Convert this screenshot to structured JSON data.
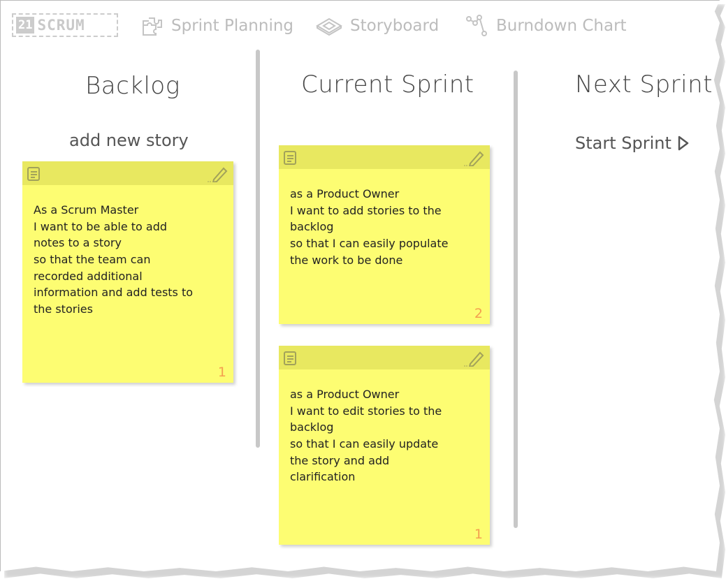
{
  "app": {
    "logo_number": "21",
    "logo_text": "SCRUM"
  },
  "nav": [
    {
      "label": "Sprint Planning",
      "icon": "puzzle-icon"
    },
    {
      "label": "Storyboard",
      "icon": "storyboard-icon"
    },
    {
      "label": "Burndown Chart",
      "icon": "burndown-icon"
    }
  ],
  "columns": {
    "backlog": {
      "title": "Backlog",
      "action": "add new story"
    },
    "current": {
      "title": "Current Sprint"
    },
    "next": {
      "title": "Next Sprint",
      "action": "Start Sprint"
    }
  },
  "stories": {
    "backlog": [
      {
        "text": "As a Scrum Master\nI want to be able to add\nnotes to a story\nso that the team can\nrecorded additional\ninformation and add tests to\nthe stories",
        "points": "1"
      }
    ],
    "current": [
      {
        "text": "as a Product Owner\nI want to add stories to the\nbacklog\nso that I can easily populate\nthe work to be done",
        "points": "2"
      },
      {
        "text": "as a Product Owner\nI want to edit stories to the\nbacklog\nso that I can easily update\nthe story and add\nclarification",
        "points": "1"
      }
    ]
  },
  "colors": {
    "note": "#fdfd72",
    "note_header": "#e8e860",
    "points": "#f4a04f",
    "nav": "#bcbcbc"
  }
}
